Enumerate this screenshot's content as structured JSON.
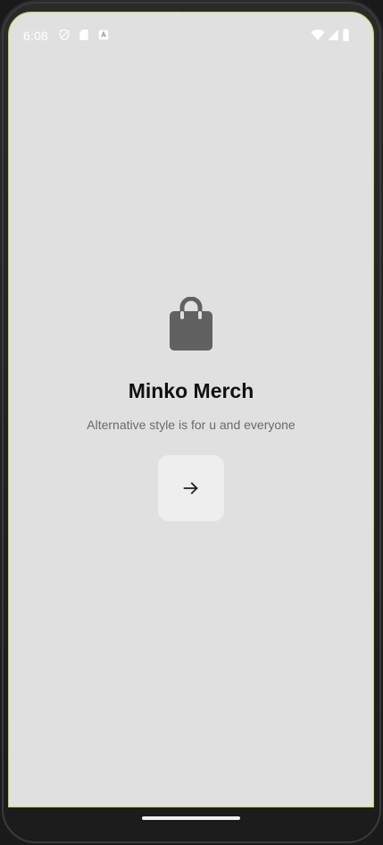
{
  "status_bar": {
    "time": "6:08",
    "left_icons": [
      "shield-icon",
      "sim-card-icon",
      "notification-icon"
    ],
    "right_icons": [
      "wifi-icon",
      "cellular-signal-icon",
      "battery-icon"
    ]
  },
  "main": {
    "icon": "shopping-bag-icon",
    "title": "Minko Merch",
    "subtitle": "Alternative style is for u and everyone",
    "next_button_icon": "arrow-right-icon"
  },
  "colors": {
    "background": "#e0e0e0",
    "icon": "#616161",
    "title": "#111111",
    "subtitle": "#6a6a6a",
    "button_bg": "#eeeeee"
  }
}
